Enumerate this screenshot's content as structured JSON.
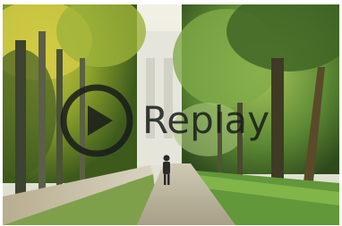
{
  "player": {
    "overlay_label": "Replay",
    "overlay_icon": "play-circle-icon",
    "overlay_color": "#1b1e1c"
  }
}
